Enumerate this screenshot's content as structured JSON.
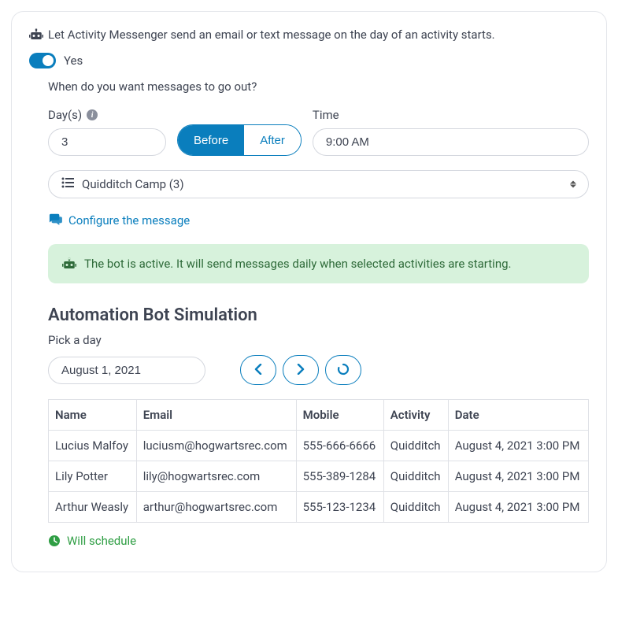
{
  "intro_text": "Let Activity Messenger send an email or text message on the day of an activity starts.",
  "toggle": {
    "label": "Yes",
    "on": true
  },
  "when_prompt": "When do you want messages to go out?",
  "days": {
    "label": "Day(s)",
    "value": "3"
  },
  "segmented": {
    "before": "Before",
    "after": "After"
  },
  "time": {
    "label": "Time",
    "value": "9:00 AM"
  },
  "activity_select": {
    "value": "Quidditch Camp  (3)"
  },
  "configure_link": "Configure the message",
  "alert_text": "The bot is active. It will send messages daily when selected activities are starting.",
  "sim": {
    "title": "Automation Bot Simulation",
    "pick_label": "Pick a day",
    "date_value": "August 1, 2021"
  },
  "table": {
    "headers": [
      "Name",
      "Email",
      "Mobile",
      "Activity",
      "Date"
    ],
    "rows": [
      {
        "name": "Lucius Malfoy",
        "email": "luciusm@hogwartsrec.com",
        "mobile": "555-666-6666",
        "activity": "Quidditch",
        "date": "August 4, 2021 3:00 PM"
      },
      {
        "name": "Lily Potter",
        "email": "lily@hogwartsrec.com",
        "mobile": "555-389-1284",
        "activity": "Quidditch",
        "date": "August 4, 2021 3:00 PM"
      },
      {
        "name": "Arthur Weasly",
        "email": "arthur@hogwartsrec.com",
        "mobile": "555-123-1234",
        "activity": "Quidditch",
        "date": "August 4, 2021 3:00 PM"
      }
    ]
  },
  "status_text": "Will schedule"
}
